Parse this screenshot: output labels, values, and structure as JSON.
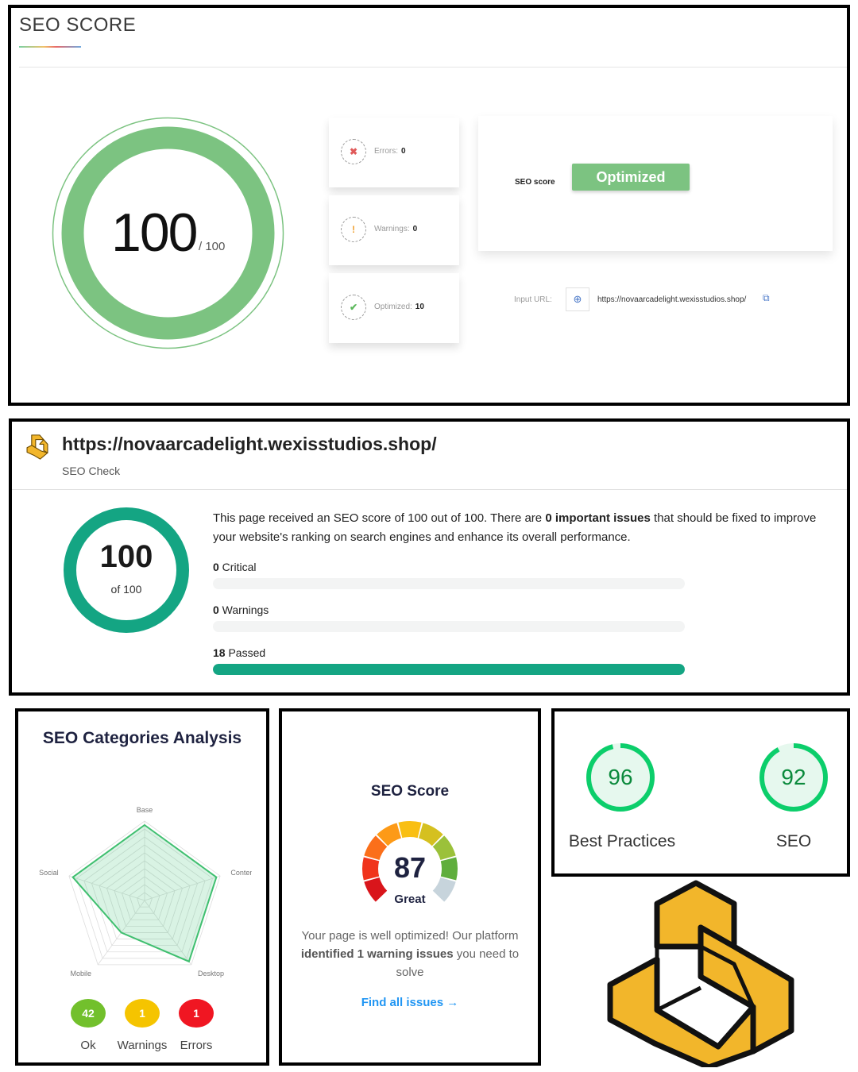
{
  "panel1": {
    "title": "SEO SCORE",
    "score": "100",
    "score_max": "/ 100",
    "errors_label": "Errors:",
    "errors_value": "0",
    "warnings_label": "Warnings:",
    "warnings_value": "0",
    "optimized_label": "Optimized:",
    "optimized_value": "10",
    "seo_score_label": "SEO score",
    "status_badge": "Optimized",
    "input_url_label": "Input URL:",
    "input_url": "https://novaarcadelight.wexisstudios.shop/",
    "gauge_color": "#7cc381"
  },
  "panel2": {
    "site_url": "https://novaarcadelight.wexisstudios.shop/",
    "subtitle": "SEO Check",
    "score": "100",
    "score_of": "of 100",
    "desc_part1": "This page received an SEO score of 100 out of 100. There are ",
    "desc_bold": "0 important issues",
    "desc_part2": " that should be fixed to improve your website's ranking on search engines and enhance its overall performance.",
    "bars": [
      {
        "count": "0",
        "label": " Critical",
        "fraction": 0
      },
      {
        "count": "0",
        "label": " Warnings",
        "fraction": 0
      },
      {
        "count": "18",
        "label": " Passed",
        "fraction": 1
      }
    ],
    "accent": "#14a583"
  },
  "panel3": {
    "title": "SEO Categories Analysis",
    "radar_labels": [
      "Base",
      "Content",
      "Desktop",
      "Mobile",
      "Social"
    ],
    "radar_values": [
      0.95,
      0.95,
      0.95,
      0.5,
      0.95
    ],
    "badges": [
      {
        "value": "42",
        "label": "Ok",
        "color": "#72c02c"
      },
      {
        "value": "1",
        "label": "Warnings",
        "color": "#f5c400"
      },
      {
        "value": "1",
        "label": "Errors",
        "color": "#f01622"
      }
    ]
  },
  "panel4": {
    "title": "SEO Score",
    "score": "87",
    "grade": "Great",
    "msg_part1": "Your page is well optimized! Our platform ",
    "msg_bold": "identified 1 warning issues",
    "msg_part2": " you need to solve",
    "link": "Find all issues",
    "arrow": "→"
  },
  "panel5": {
    "items": [
      {
        "value": "96",
        "label": "Best Practices",
        "fraction": 0.96
      },
      {
        "value": "92",
        "label": "SEO",
        "fraction": 0.92
      }
    ],
    "ring_color": "#0cce6b"
  },
  "icons": {
    "error": "✖",
    "warning": "!",
    "ok": "✔",
    "globe": "⊕",
    "external": "⧉"
  },
  "logo_color": "#f2b62b"
}
